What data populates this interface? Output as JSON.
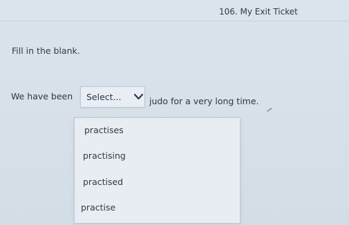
{
  "quiz": {
    "title": "106. My Exit Ticket",
    "prompt": "Fill in the blank.",
    "sentence_before": "We have been",
    "sentence_after": "judo for a very long time.",
    "select_value": "Select...",
    "options": [
      "practises",
      "practising",
      "practised",
      "practise"
    ]
  }
}
